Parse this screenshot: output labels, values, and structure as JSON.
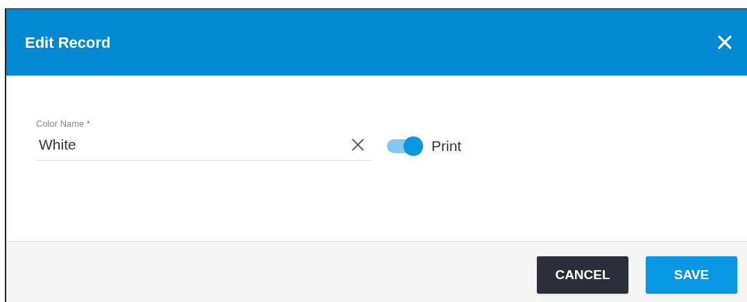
{
  "dialog": {
    "title": "Edit Record"
  },
  "field": {
    "label": "Color Name *",
    "value": "White"
  },
  "toggle": {
    "label": "Print",
    "on": true
  },
  "buttons": [
    {
      "label": "CANCEL",
      "kind": "secondary"
    },
    {
      "label": "SAVE",
      "kind": "primary"
    }
  ]
}
